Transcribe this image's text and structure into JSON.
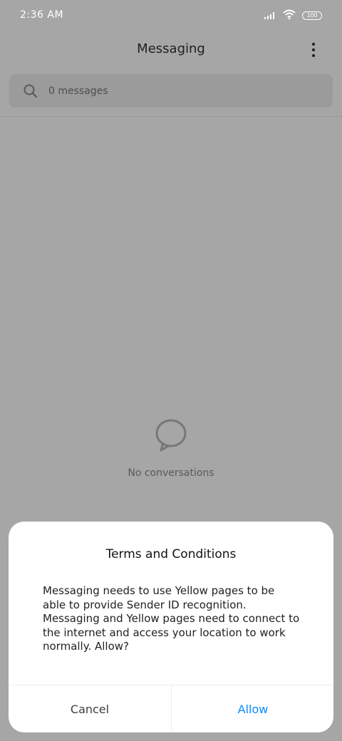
{
  "status_bar": {
    "time": "2:36 AM",
    "battery": "100"
  },
  "header": {
    "title": "Messaging"
  },
  "search": {
    "placeholder": "0 messages"
  },
  "empty_state": {
    "label": "No conversations"
  },
  "dialog": {
    "title": "Terms and Conditions",
    "body": "Messaging needs to use Yellow pages to be able to provide Sender ID recognition. Messaging and Yellow pages need to connect to the internet and access your location to work normally. Allow?",
    "cancel_label": "Cancel",
    "allow_label": "Allow"
  },
  "colors": {
    "accent": "#0a8bff"
  }
}
